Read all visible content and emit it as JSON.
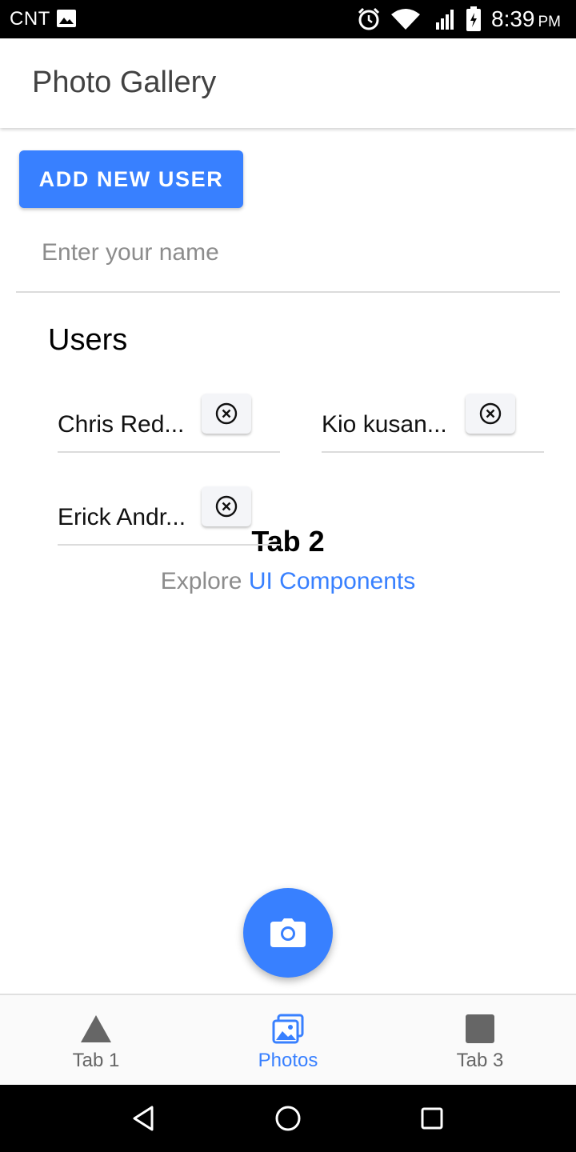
{
  "status_bar": {
    "carrier": "CNT",
    "time": "8:39",
    "ampm": "PM",
    "icons": [
      "image-icon",
      "alarm-icon",
      "wifi-icon",
      "signal-icon",
      "battery-icon"
    ]
  },
  "header": {
    "title": "Photo Gallery"
  },
  "add_user_button": {
    "label": "ADD NEW USER"
  },
  "name_input": {
    "placeholder": "Enter your name",
    "value": ""
  },
  "users": {
    "heading": "Users",
    "items": [
      {
        "name": "Chris Red..."
      },
      {
        "name": "Kio kusan..."
      },
      {
        "name": "Erick Andr..."
      }
    ]
  },
  "tab_content": {
    "title": "Tab 2",
    "explore_prefix": "Explore",
    "explore_link": "UI Components"
  },
  "fab": {
    "icon": "camera-icon"
  },
  "tabs": [
    {
      "label": "Tab 1",
      "icon": "triangle-icon",
      "active": false
    },
    {
      "label": "Photos",
      "icon": "images-icon",
      "active": true
    },
    {
      "label": "Tab 3",
      "icon": "square-icon",
      "active": false
    }
  ],
  "colors": {
    "primary": "#3880ff",
    "header_text": "#424242",
    "inactive_tab": "#666666"
  }
}
